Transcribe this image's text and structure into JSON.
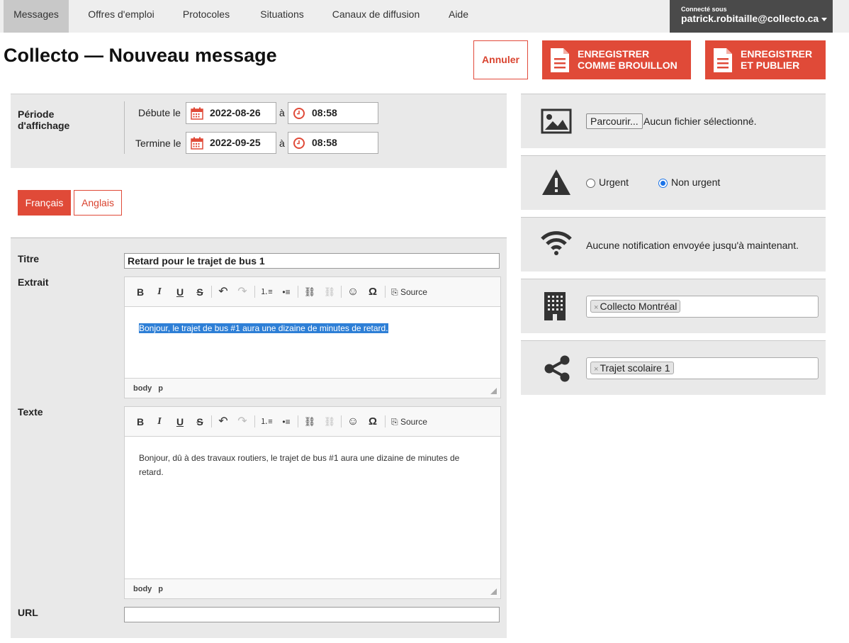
{
  "nav": {
    "items": [
      "Messages",
      "Offres d'emploi",
      "Protocoles",
      "Situations",
      "Canaux de diffusion",
      "Aide"
    ],
    "user_label": "Connecté sous",
    "user_email": "patrick.robitaille@collecto.ca"
  },
  "page": {
    "title": "Collecto — Nouveau message"
  },
  "actions": {
    "cancel": "Annuler",
    "save_draft_line1": "ENREGISTRER",
    "save_draft_line2": "COMME BROUILLON",
    "publish_line1": "ENREGISTRER",
    "publish_line2": "ET PUBLIER"
  },
  "periode": {
    "label_line1": "Période",
    "label_line2": "d'affichage",
    "start_label": "Débute le",
    "start_date": "2022-08-26",
    "start_time": "08:58",
    "end_label": "Termine le",
    "end_date": "2022-09-25",
    "end_time": "08:58",
    "at": "à"
  },
  "languages": {
    "fr": "Français",
    "en": "Anglais"
  },
  "form": {
    "titre_label": "Titre",
    "titre_value": "Retard pour le trajet de bus 1",
    "extrait_label": "Extrait",
    "extrait_value": "Bonjour, le trajet de bus #1 aura une dizaine de minutes de retard.",
    "texte_label": "Texte",
    "texte_value": "Bonjour, dû à des travaux routiers, le trajet de bus #1 aura une dizaine de minutes de retard.",
    "url_label": "URL",
    "url_value": "",
    "source_label": "Source",
    "path_body": "body",
    "path_p": "p"
  },
  "side": {
    "browse_button": "Parcourir...",
    "no_file": "Aucun fichier sélectionné.",
    "urgent": "Urgent",
    "non_urgent": "Non urgent",
    "selected_priority": "Non urgent",
    "notification_text": "Aucune notification envoyée jusqu'à maintenant.",
    "organization_tag": "Collecto Montréal",
    "channel_tag": "Trajet scolaire 1"
  },
  "colors": {
    "accent": "#e04a38",
    "nav_dark": "#4a4a4a",
    "panel_bg": "#e9e9e9",
    "selection": "#2e7fd6"
  }
}
